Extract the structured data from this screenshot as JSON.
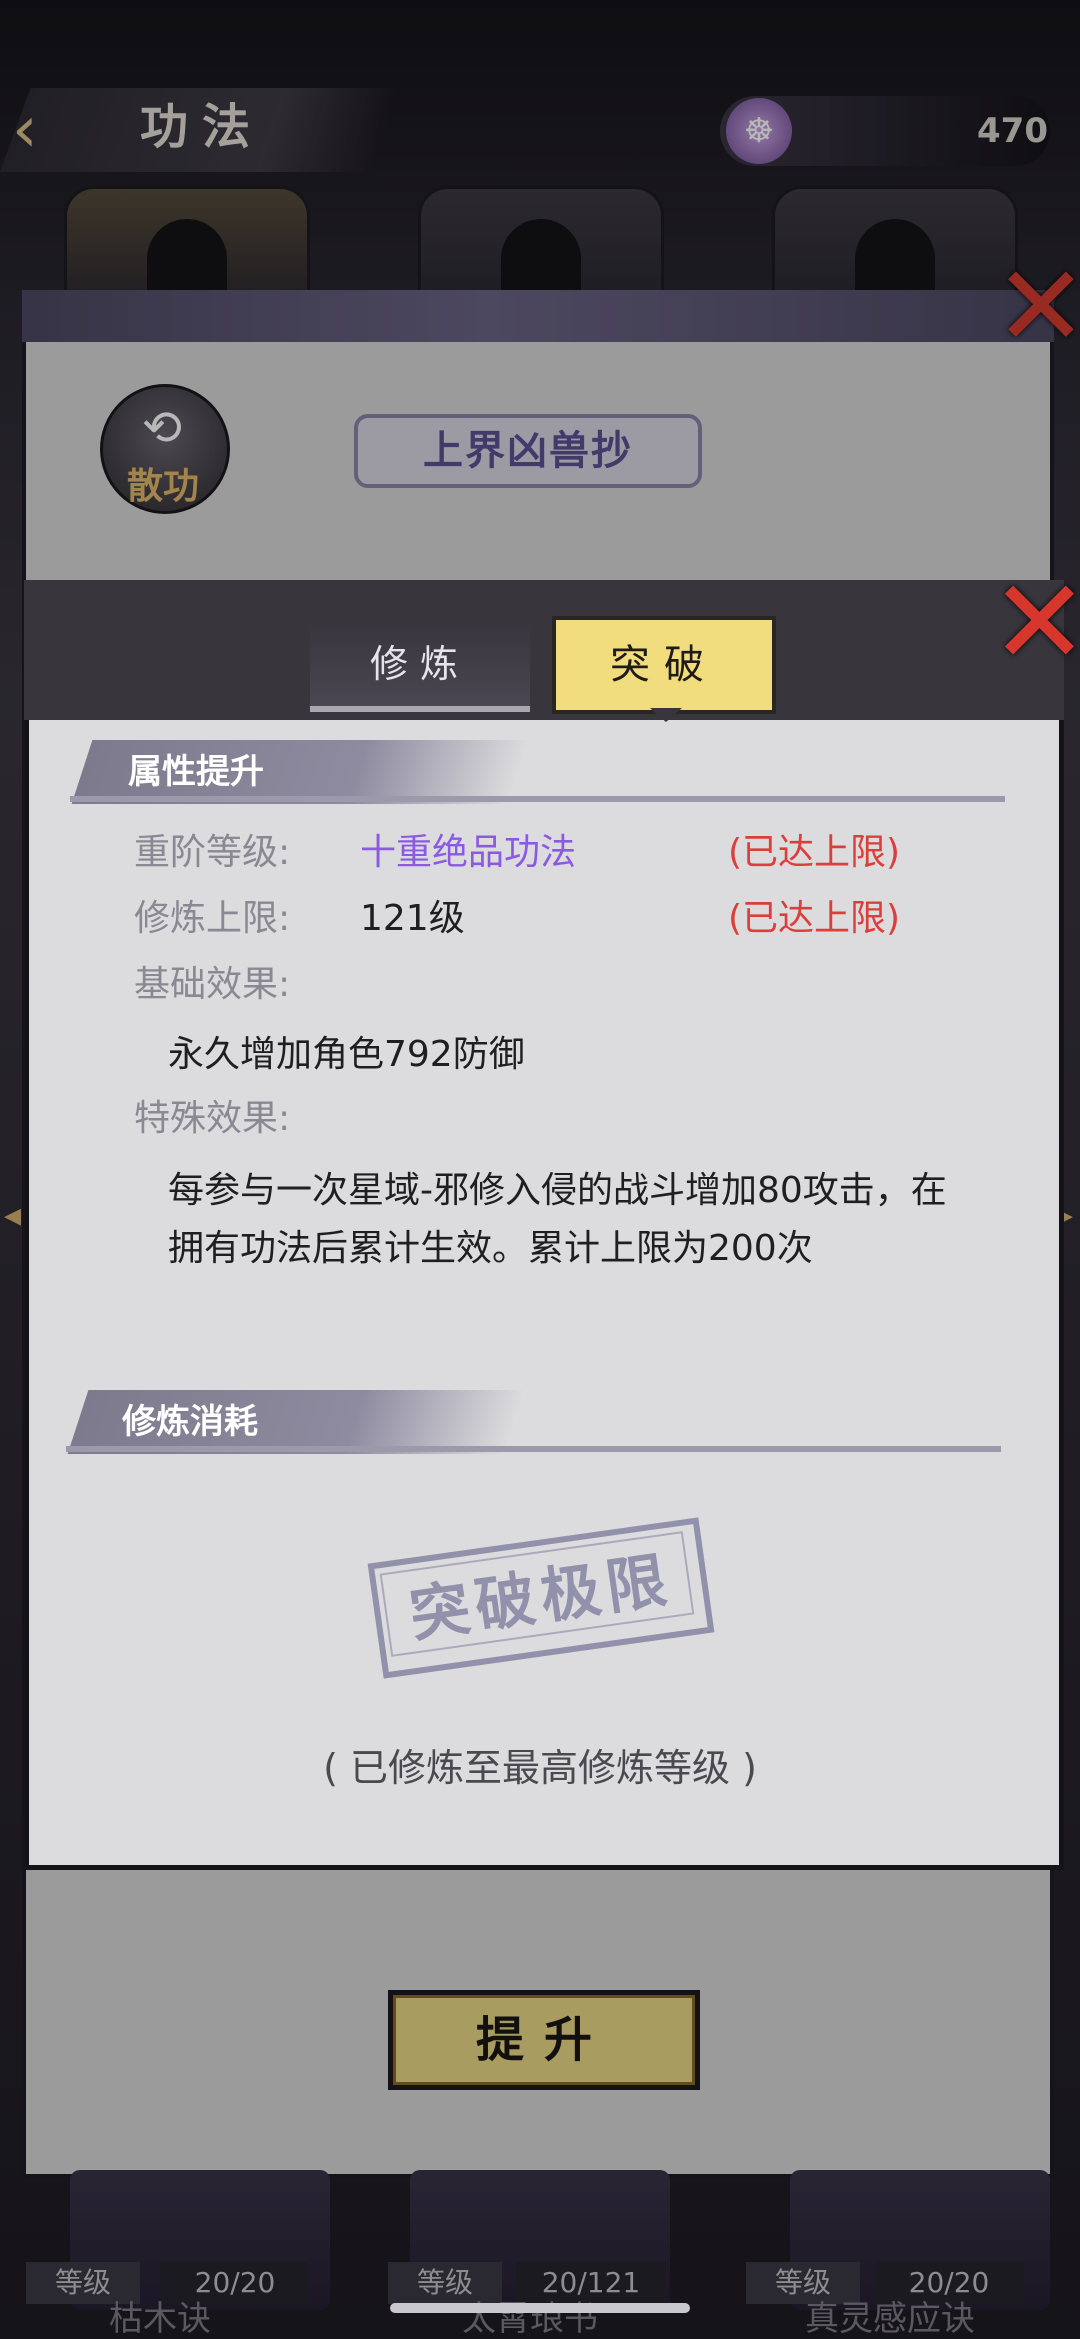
{
  "header": {
    "back_icon": "back-arrow-icon",
    "title": "功法",
    "currency_icon": "meditation-icon",
    "currency_value": "470"
  },
  "back_panel": {
    "type_badge": "散功",
    "technique_name": "上界凶兽抄",
    "upgrade_button": "提升"
  },
  "bottom_list": [
    {
      "level_label": "等级",
      "level_value": "20/20",
      "name": "枯木诀"
    },
    {
      "level_label": "等级",
      "level_value": "20/121",
      "name": "太霄琅书"
    },
    {
      "level_label": "等级",
      "level_value": "20/20",
      "name": "真灵感应诀"
    }
  ],
  "dialog": {
    "tabs": [
      "修炼",
      "突破"
    ],
    "active_tab": "突破",
    "section1_title": "属性提升",
    "rows": [
      {
        "label": "重阶等级:",
        "value": "十重绝品功法",
        "status": "(已达上限)"
      },
      {
        "label": "修炼上限:",
        "value": "121级",
        "status": "(已达上限)"
      }
    ],
    "basic_label": "基础效果:",
    "basic_effect": "永久增加角色792防御",
    "special_label": "特殊效果:",
    "special_effect": "每参与一次星域-邪修入侵的战斗增加80攻击，在拥有功法后累计生效。累计上限为200次",
    "section2_title": "修炼消耗",
    "stamp_text": "突破极限",
    "max_note": "( 已修炼至最高修炼等级 )"
  },
  "colors": {
    "accent_purple": "#8a5ae0",
    "status_red": "#dc3f3b",
    "tab_active": "#f2dd7e",
    "close_red": "#d6362c"
  }
}
